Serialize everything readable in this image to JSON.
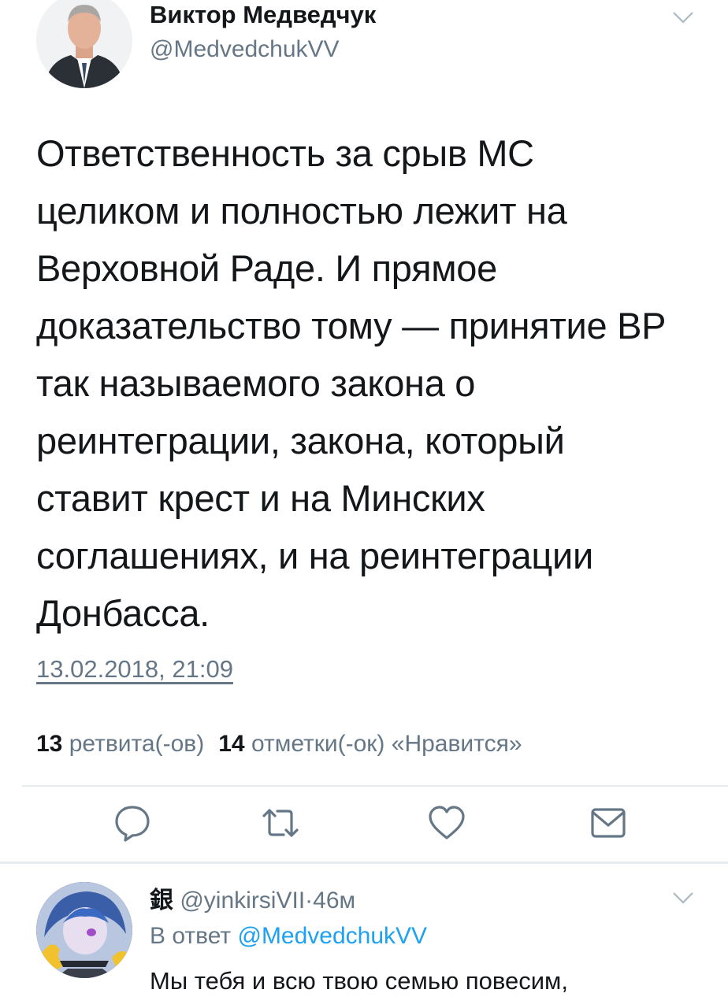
{
  "tweet": {
    "author_name": "Виктор Медведчук",
    "author_handle": "@MedvedchukVV",
    "text_lines": [
      "Ответственность за срыв МС",
      "целиком и полностью лежит на",
      "Верховной Раде. И прямое",
      "доказательство тому — принятие ВР",
      "так называемого закона о",
      "реинтеграции, закона, который",
      "ставит крест и на Минских",
      "соглашениях, и на реинтеграции",
      "Донбасса."
    ],
    "timestamp": "13.02.2018, 21:09",
    "retweets_count": "13",
    "retweets_label": "ретвита(-ов)",
    "likes_count": "14",
    "likes_label": "отметки(-ок) «Нравится»"
  },
  "actions": {
    "reply_icon": "speech-bubble-icon",
    "retweet_icon": "retweet-arrows-icon",
    "like_icon": "heart-icon",
    "dm_icon": "envelope-icon"
  },
  "reply": {
    "author_name": "銀",
    "author_handle": "@yinkirsiVII",
    "separator": "·",
    "time": "46м",
    "in_reply_prefix": "В ответ",
    "in_reply_mention": "@MedvedchukVV",
    "text": "Мы тебя и всю твою семью повесим,"
  },
  "colors": {
    "text": "#14171a",
    "secondary": "#657786",
    "link": "#1da1f2",
    "divider": "#e6ecf0"
  }
}
